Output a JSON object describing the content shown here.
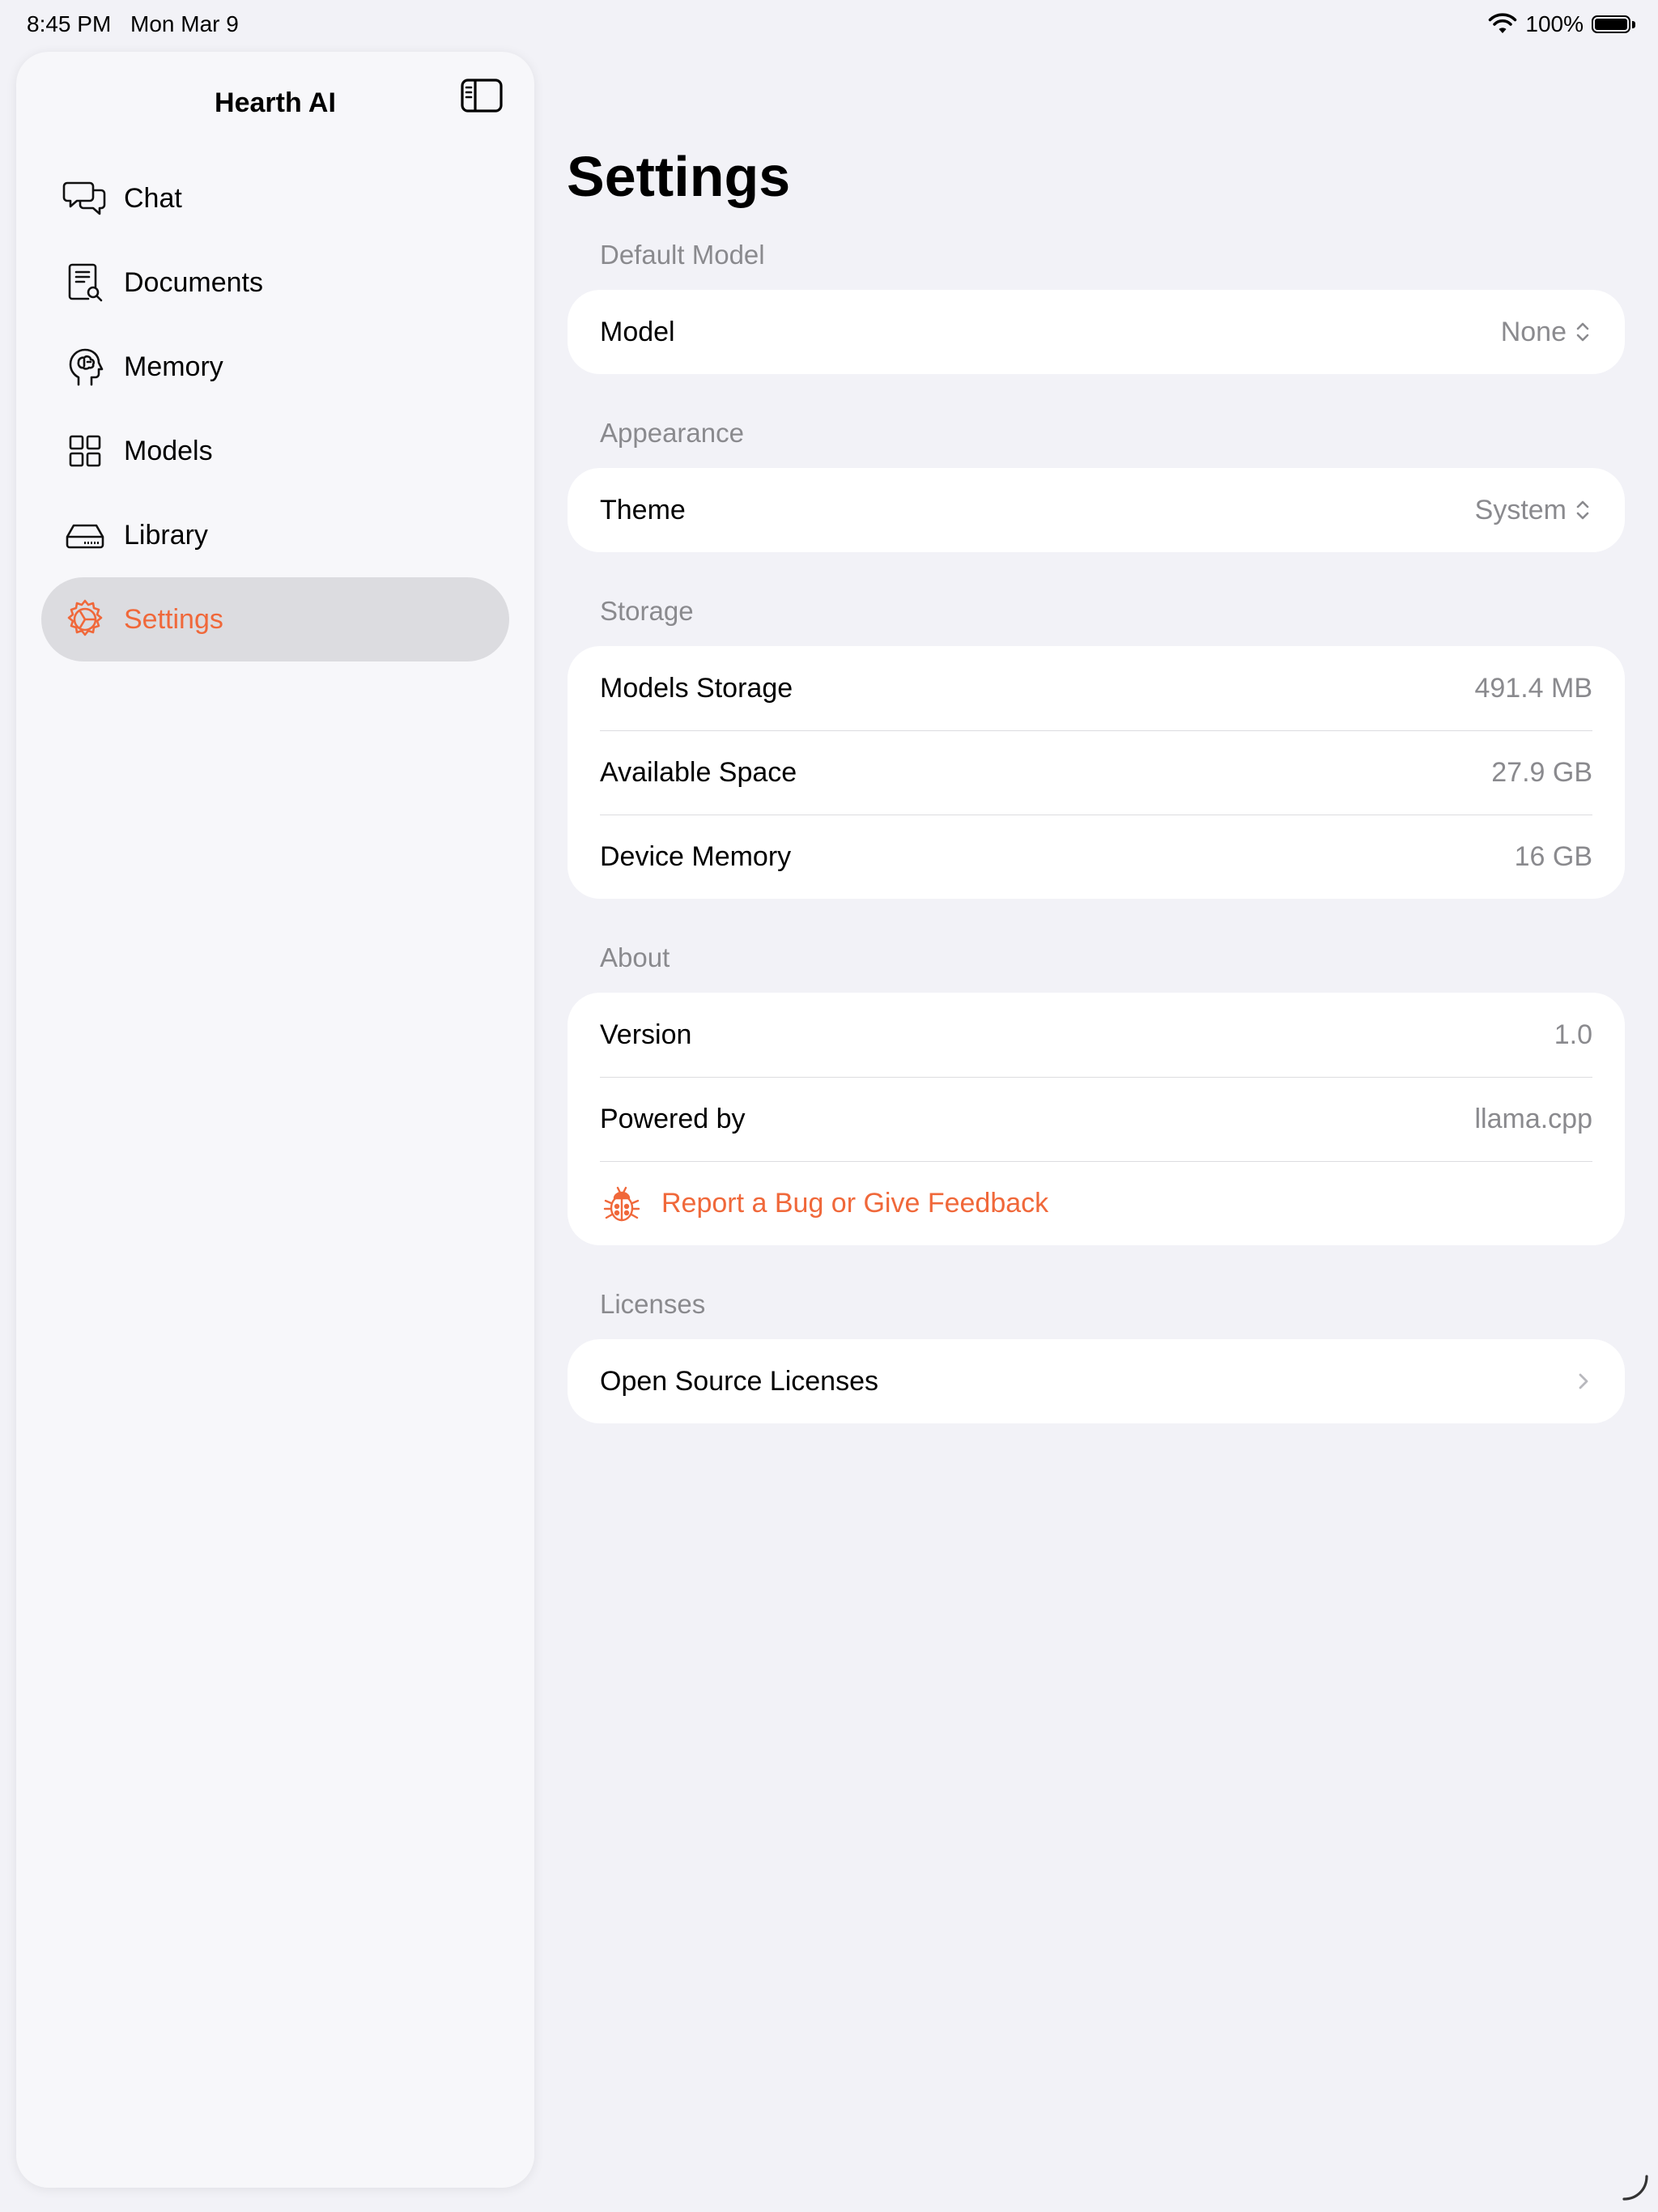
{
  "status_bar": {
    "time": "8:45 PM",
    "date": "Mon Mar 9",
    "battery": "100%"
  },
  "sidebar": {
    "title": "Hearth AI",
    "items": [
      {
        "label": "Chat",
        "icon": "chat-bubbles-icon",
        "active": false
      },
      {
        "label": "Documents",
        "icon": "document-search-icon",
        "active": false
      },
      {
        "label": "Memory",
        "icon": "brain-head-icon",
        "active": false
      },
      {
        "label": "Models",
        "icon": "grid-icon",
        "active": false
      },
      {
        "label": "Library",
        "icon": "drive-icon",
        "active": false
      },
      {
        "label": "Settings",
        "icon": "gear-icon",
        "active": true
      }
    ]
  },
  "main": {
    "title": "Settings",
    "sections": {
      "default_model": {
        "header": "Default Model",
        "model": {
          "label": "Model",
          "value": "None"
        }
      },
      "appearance": {
        "header": "Appearance",
        "theme": {
          "label": "Theme",
          "value": "System"
        }
      },
      "storage": {
        "header": "Storage",
        "rows": [
          {
            "label": "Models Storage",
            "value": "491.4 MB"
          },
          {
            "label": "Available Space",
            "value": "27.9 GB"
          },
          {
            "label": "Device Memory",
            "value": "16 GB"
          }
        ]
      },
      "about": {
        "header": "About",
        "version": {
          "label": "Version",
          "value": "1.0"
        },
        "powered_by": {
          "label": "Powered by",
          "value": "llama.cpp"
        },
        "feedback": {
          "label": "Report a Bug or Give Feedback"
        }
      },
      "licenses": {
        "header": "Licenses",
        "open_source": {
          "label": "Open Source Licenses"
        }
      }
    }
  },
  "colors": {
    "accent": "#f0683a",
    "background": "#f2f2f7",
    "secondary_text": "#8a8a8e",
    "selected_row": "#dcdce0"
  }
}
